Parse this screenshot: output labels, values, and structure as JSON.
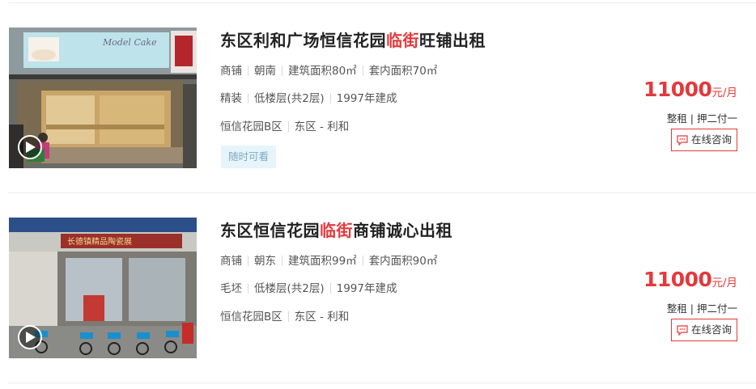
{
  "listings": [
    {
      "title_pre": "东区利和广场恒信花园",
      "title_hl": "临街",
      "title_post": "旺铺出租",
      "row1": [
        "商铺",
        "朝南",
        "建筑面积80㎡",
        "套内面积70㎡"
      ],
      "row2": [
        "精装",
        "低楼层(共2层)",
        "1997年建成"
      ],
      "row3": [
        "恒信花园B区",
        "东区 - 利和"
      ],
      "tag": "随时可看",
      "price": "11000",
      "price_unit": "元/月",
      "terms": "整租 | 押二付一",
      "consult_label": "在线咨询",
      "photo_sign_text": "Model Cake"
    },
    {
      "title_pre": "东区恒信花园",
      "title_hl": "临街",
      "title_post": "商铺诚心出租",
      "row1": [
        "商铺",
        "朝东",
        "建筑面积99㎡",
        "套内面积90㎡"
      ],
      "row2": [
        "毛坯",
        "低楼层(共2层)",
        "1997年建成"
      ],
      "row3": [
        "恒信花园B区",
        "东区 - 利和"
      ],
      "price": "11000",
      "price_unit": "元/月",
      "terms": "整租 | 押二付一",
      "consult_label": "在线咨询",
      "photo_sign_text": "长德镇精品陶瓷展"
    }
  ],
  "colors": {
    "accent_red": "#e4393c",
    "tag_bg": "#e6f4fb",
    "tag_text": "#7fa9c4"
  },
  "icons": [
    "play-icon",
    "chat-icon"
  ]
}
